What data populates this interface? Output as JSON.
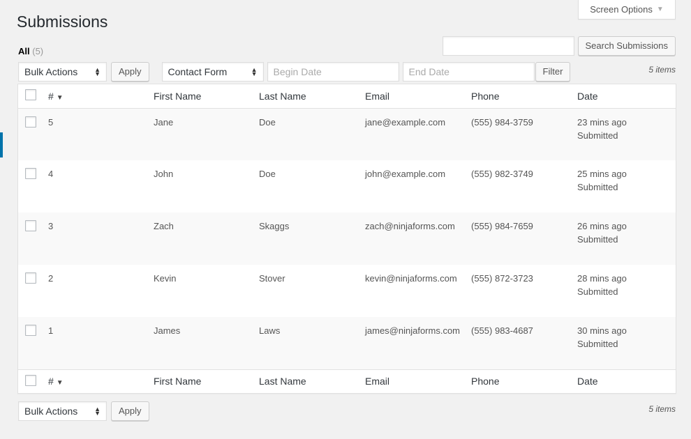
{
  "screen_options": {
    "label": "Screen Options",
    "icon": "triangle-down-icon"
  },
  "page": {
    "title": "Submissions"
  },
  "views": {
    "all_label": "All",
    "all_count": "(5)"
  },
  "search": {
    "value": "",
    "placeholder": "",
    "button": "Search Submissions"
  },
  "toolbar_top": {
    "bulk_actions": "Bulk Actions",
    "apply": "Apply",
    "form_select": "Contact Form",
    "begin_date_placeholder": "Begin Date",
    "end_date_placeholder": "End Date",
    "filter": "Filter",
    "items": "5 items"
  },
  "toolbar_bottom": {
    "bulk_actions": "Bulk Actions",
    "apply": "Apply",
    "items": "5 items"
  },
  "columns": {
    "id": "#",
    "first": "First Name",
    "last": "Last Name",
    "email": "Email",
    "phone": "Phone",
    "date": "Date"
  },
  "rows": [
    {
      "id": "5",
      "first": "Jane",
      "last": "Doe",
      "email": "jane@example.com",
      "phone": "(555) 984-3759",
      "date": "23 mins ago",
      "status": "Submitted"
    },
    {
      "id": "4",
      "first": "John",
      "last": "Doe",
      "email": "john@example.com",
      "phone": "(555) 982-3749",
      "date": "25 mins ago",
      "status": "Submitted"
    },
    {
      "id": "3",
      "first": "Zach",
      "last": "Skaggs",
      "email": "zach@ninjaforms.com",
      "phone": "(555) 984-7659",
      "date": "26 mins ago",
      "status": "Submitted"
    },
    {
      "id": "2",
      "first": "Kevin",
      "last": "Stover",
      "email": "kevin@ninjaforms.com",
      "phone": "(555) 872-3723",
      "date": "28 mins ago",
      "status": "Submitted"
    },
    {
      "id": "1",
      "first": "James",
      "last": "Laws",
      "email": "james@ninjaforms.com",
      "phone": "(555) 983-4687",
      "date": "30 mins ago",
      "status": "Submitted"
    }
  ],
  "colors": {
    "accent": "#0073aa",
    "background": "#f1f1f1",
    "stripe": "#f9f9f9"
  }
}
